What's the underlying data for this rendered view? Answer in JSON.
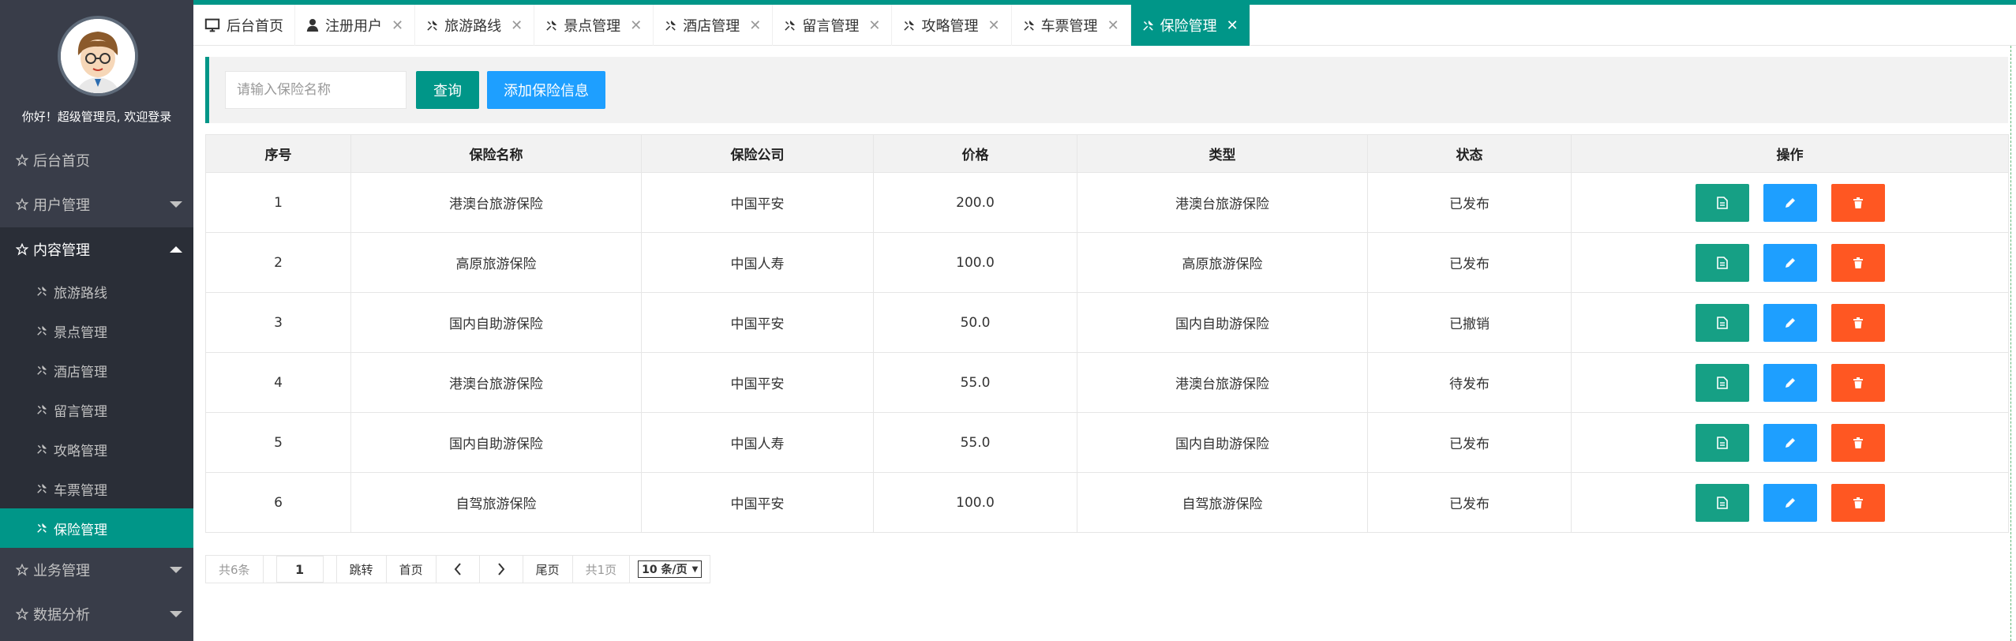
{
  "sidebar": {
    "greeting": "你好！超级管理员, 欢迎登录",
    "items": [
      {
        "label": "后台首页",
        "icon": "star-icon"
      },
      {
        "label": "用户管理",
        "icon": "star-icon"
      },
      {
        "label": "内容管理",
        "icon": "star-icon"
      },
      {
        "label": "业务管理",
        "icon": "star-icon"
      },
      {
        "label": "数据分析",
        "icon": "star-icon"
      }
    ],
    "sub_items": [
      {
        "label": "旅游路线",
        "icon": "wrench-icon"
      },
      {
        "label": "景点管理",
        "icon": "wrench-icon"
      },
      {
        "label": "酒店管理",
        "icon": "wrench-icon"
      },
      {
        "label": "留言管理",
        "icon": "wrench-icon"
      },
      {
        "label": "攻略管理",
        "icon": "wrench-icon"
      },
      {
        "label": "车票管理",
        "icon": "wrench-icon"
      },
      {
        "label": "保险管理",
        "icon": "wrench-icon"
      }
    ]
  },
  "tabs": [
    {
      "label": "后台首页",
      "icon": "monitor-icon"
    },
    {
      "label": "注册用户",
      "icon": "user-icon"
    },
    {
      "label": "旅游路线",
      "icon": "wrench-icon"
    },
    {
      "label": "景点管理",
      "icon": "wrench-icon"
    },
    {
      "label": "酒店管理",
      "icon": "wrench-icon"
    },
    {
      "label": "留言管理",
      "icon": "wrench-icon"
    },
    {
      "label": "攻略管理",
      "icon": "wrench-icon"
    },
    {
      "label": "车票管理",
      "icon": "wrench-icon"
    },
    {
      "label": "保险管理",
      "icon": "wrench-icon"
    }
  ],
  "search": {
    "placeholder": "请输入保险名称",
    "query_label": "查询",
    "add_label": "添加保险信息"
  },
  "table": {
    "headers": [
      "序号",
      "保险名称",
      "保险公司",
      "价格",
      "类型",
      "状态",
      "操作"
    ],
    "rows": [
      [
        "1",
        "港澳台旅游保险",
        "中国平安",
        "200.0",
        "港澳台旅游保险",
        "已发布"
      ],
      [
        "2",
        "高原旅游保险",
        "中国人寿",
        "100.0",
        "高原旅游保险",
        "已发布"
      ],
      [
        "3",
        "国内自助游保险",
        "中国平安",
        "50.0",
        "国内自助游保险",
        "已撤销"
      ],
      [
        "4",
        "港澳台旅游保险",
        "中国平安",
        "55.0",
        "港澳台旅游保险",
        "待发布"
      ],
      [
        "5",
        "国内自助游保险",
        "中国人寿",
        "55.0",
        "国内自助游保险",
        "已发布"
      ],
      [
        "6",
        "自驾旅游保险",
        "中国平安",
        "100.0",
        "自驾旅游保险",
        "已发布"
      ]
    ]
  },
  "pager": {
    "total": "共6条",
    "page_value": "1",
    "jump_label": "跳转",
    "first_label": "首页",
    "last_label": "尾页",
    "pages": "共1页",
    "size_option": "10 条/页"
  },
  "colors": {
    "accent": "#009688",
    "sidebar": "#393d49",
    "blue": "#1e9fff",
    "orange": "#ff5722"
  }
}
